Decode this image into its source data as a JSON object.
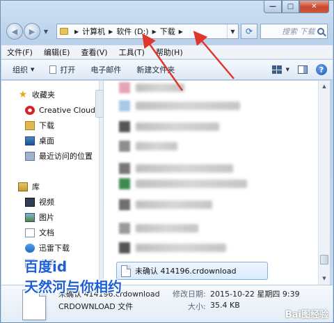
{
  "window": {
    "caption": {
      "minimize": "—",
      "maximize": "□",
      "close": "✕"
    }
  },
  "address": {
    "crumbs": [
      "计算机",
      "软件 (D:)",
      "下载"
    ],
    "search_placeholder": "搜索 下载"
  },
  "menubar": [
    "文件(F)",
    "编辑(E)",
    "查看(V)",
    "工具(T)",
    "帮助(H)"
  ],
  "toolbar": {
    "organize": "组织",
    "open": "打开",
    "email": "电子邮件",
    "new_folder": "新建文件夹",
    "help": "?"
  },
  "navpane": {
    "favorites": "收藏夹",
    "creative_cloud": "Creative Cloud",
    "downloads": "下载",
    "desktop": "桌面",
    "recent": "最近访问的位置",
    "libraries": "库",
    "videos": "视频",
    "pictures": "图片",
    "documents": "文档",
    "xunlei": "迅雷下载",
    "music": "音乐"
  },
  "files": {
    "selected_name": "未确认 414196.crdownload"
  },
  "details": {
    "name": "未确认 414196.crdownload",
    "type": "CRDOWNLOAD 文件",
    "modified_label": "修改日期:",
    "modified_value": "2015-10-22 星期四 9:39",
    "size_label": "大小:",
    "size_value": "35.4 KB"
  },
  "watermark": {
    "line1": "百度id",
    "line2": "天然河与你相约",
    "corner": "Bai图经验"
  },
  "colors": {
    "annotation_arrow": "#e0352b",
    "watermark_blue": "#1f5fd6"
  }
}
